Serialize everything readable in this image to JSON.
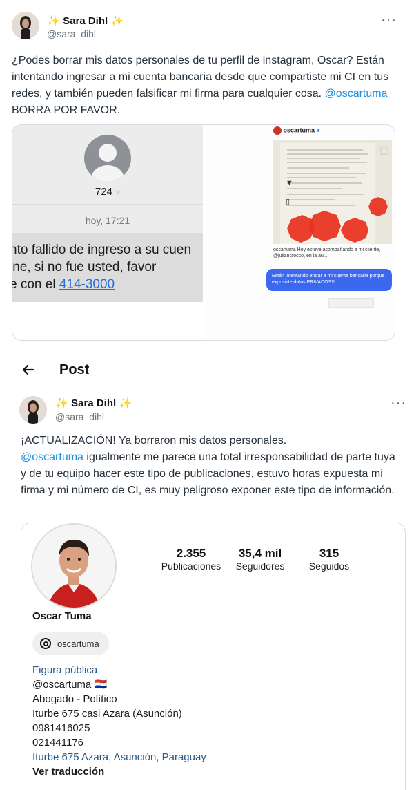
{
  "tweet1": {
    "display_name": "Sara Dihl",
    "sparkle": "✨",
    "handle": "@sara_dihl",
    "more": "···",
    "text_part1": "¿Podes borrar mis datos personales de tu perfil de instagram, Oscar? Están intentando ingresar a mi cuenta bancaria desde que compartiste mi CI en tus redes, y también pueden falsificar mi firma para cualquier cosa. ",
    "mention": "@oscartuma",
    "text_part2": " BORRA POR FAVOR.",
    "sms": {
      "sender": "724",
      "sender_chevron": ">",
      "time": "hoy, 17:21",
      "line1": "nto fallido de ingreso a su cuen",
      "line2": "ine, si no fue usted, favor",
      "line3_prefix": "e con el ",
      "phone_link": "414-3000"
    },
    "ig": {
      "account": "oscartuma",
      "caption": "oscartuma Hoy estuve acompañando a mi cliente, @juliancrocco, en la au...",
      "dm_bubble": "Están intentando entrar a mi cuenta bancaria porque expusiste datos PRIVADOS!!!"
    }
  },
  "post_header": {
    "title": "Post"
  },
  "tweet2": {
    "display_name": "Sara Dihl",
    "sparkle": "✨",
    "handle": "@sara_dihl",
    "more": "···",
    "line1": "¡ACTUALIZACIÓN! Ya borraron mis datos personales.",
    "mention": "@oscartuma",
    "rest": " igualmente me parece una total irresponsabilidad de parte tuya y de tu equipo hacer este tipo de publicaciones, estuvo horas expuesta mi firma y mi número de CI, es muy peligroso exponer este tipo de información."
  },
  "profile": {
    "stats": [
      {
        "value": "2.355",
        "label": "Publicaciones"
      },
      {
        "value": "35,4 mil",
        "label": "Seguidores"
      },
      {
        "value": "315",
        "label": "Seguidos"
      }
    ],
    "name": "Oscar Tuma",
    "threads_handle": "oscartuma",
    "category": "Figura pública",
    "ig_handle": "@oscartuma",
    "flag": "🇵🇾",
    "bio_line1": "Abogado - Político",
    "bio_line2": "Iturbe 675 casi Azara (Asunción)",
    "bio_line3": "0981416025",
    "bio_line4": "021441176",
    "address_link": "Iturbe 675 Azara, Asunción, Paraguay",
    "translate": "Ver traducción"
  },
  "colors": {
    "mention": "#1d8fe0",
    "sparkle": "#f5b90a",
    "dm_bubble": "#3c68f0",
    "redaction": "#e8301c",
    "shirt": "#c81f1f"
  }
}
